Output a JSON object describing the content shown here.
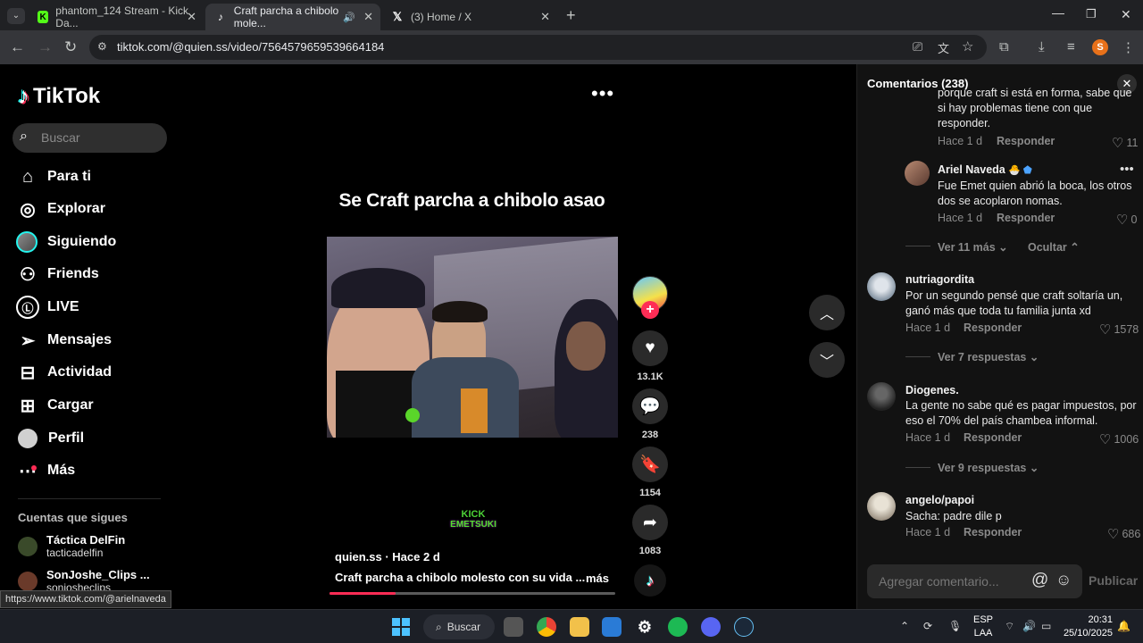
{
  "browser": {
    "tabs": [
      {
        "title": "phantom_124 Stream - Kick Da...",
        "favicon": "K",
        "favicon_color": "#53fc18",
        "active": false
      },
      {
        "title": "Craft parcha a chibolo mole...",
        "favicon": "tiktok",
        "favicon_color": "#ffffff",
        "active": true
      },
      {
        "title": "(3) Home / X",
        "favicon": "X",
        "favicon_color": "#ffffff",
        "active": false
      }
    ],
    "url": "tiktok.com/@quien.ss/video/7564579659539664184",
    "profile_initial": "S",
    "profile_color": "#e8711a"
  },
  "sidebar": {
    "brand": "TikTok",
    "search_placeholder": "Buscar",
    "nav": [
      {
        "label": "Para ti",
        "icon": "home-icon"
      },
      {
        "label": "Explorar",
        "icon": "compass-icon"
      },
      {
        "label": "Siguiendo",
        "icon": "avatar-icon"
      },
      {
        "label": "Friends",
        "icon": "friends-icon"
      },
      {
        "label": "LIVE",
        "icon": "live-icon"
      },
      {
        "label": "Mensajes",
        "icon": "send-icon"
      },
      {
        "label": "Actividad",
        "icon": "activity-icon"
      },
      {
        "label": "Cargar",
        "icon": "upload-icon"
      },
      {
        "label": "Perfil",
        "icon": "profile-icon"
      },
      {
        "label": "Más",
        "icon": "more-icon"
      }
    ],
    "following_title": "Cuentas que sigues",
    "following": [
      {
        "name": "Táctica DelFin",
        "handle": "tacticadelfin"
      },
      {
        "name": "SonJoshe_Clips ...",
        "handle": "sonjosheclips"
      }
    ],
    "status_url": "https://www.tiktok.com/@arielnaveda"
  },
  "video": {
    "title": "Se Craft parcha a chibolo asao",
    "author_line": "quien.ss · Hace 2 d",
    "description": "Craft parcha a chibolo molesto con su vida ...",
    "more_label": "más",
    "watermark_line1": "KICK",
    "watermark_line2": "EMETSUKI",
    "progress": 0.23,
    "actions": {
      "likes": "13.1K",
      "comments": "238",
      "saves": "1154",
      "shares": "1083"
    }
  },
  "comments": {
    "title": "Comentarios (238)",
    "items": [
      {
        "text_lines": [
          "porque craft si está en forma, sabe que",
          "si hay problemas tiene con que",
          "responder."
        ],
        "time": "Hace 1 d",
        "reply": "Responder",
        "likes": "11"
      },
      {
        "user": "Ariel Naveda",
        "badges": "🐣 ⬟",
        "text_lines": [
          "Fue Emet quien abrió la boca, los otros",
          "dos se acoplaron nomas."
        ],
        "time": "Hace 1 d",
        "reply": "Responder",
        "likes": "0"
      },
      {
        "user": "nutriagordita",
        "text_lines": [
          "Por un segundo pensé que craft soltaría un,",
          "ganó más que toda tu familia junta xd"
        ],
        "time": "Hace 1 d",
        "reply": "Responder",
        "likes": "1578"
      },
      {
        "user": "Diogenes.",
        "text_lines": [
          "La gente no sabe qué es pagar impuestos, por",
          "eso el 70% del país chambea informal."
        ],
        "time": "Hace 1 d",
        "reply": "Responder",
        "likes": "1006"
      },
      {
        "user": "angelo/papoi",
        "text_lines": [
          "Sacha: padre dile p"
        ],
        "time": "Hace 1 d",
        "reply": "Responder",
        "likes": "686"
      }
    ],
    "view_more_replies_1": "Ver 11 más",
    "hide_label": "Ocultar",
    "view_more_replies_2": "Ver 7 respuestas",
    "view_more_replies_3": "Ver 9 respuestas",
    "input_placeholder": "Agregar comentario...",
    "publish_label": "Publicar"
  },
  "taskbar": {
    "search_label": "Buscar",
    "lang_line1": "ESP",
    "lang_line2": "LAA",
    "time": "20:31",
    "date": "25/10/2025"
  }
}
